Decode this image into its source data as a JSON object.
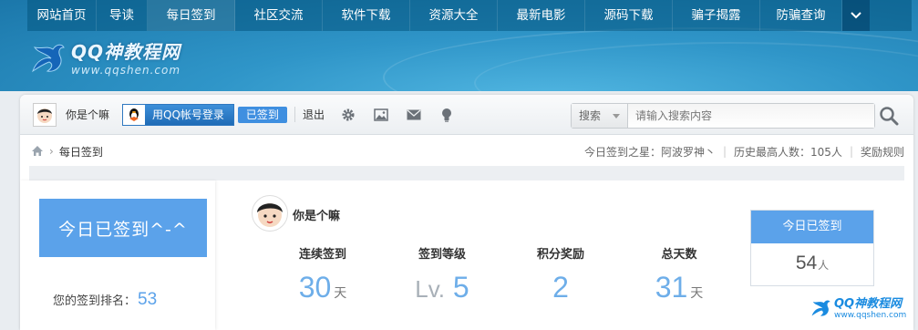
{
  "nav": {
    "items": [
      "网站首页",
      "导读",
      "每日签到",
      "社区交流",
      "软件下载",
      "资源大全",
      "最新电影",
      "源码下载",
      "骗子揭露",
      "防骗查询"
    ],
    "active_index": 2
  },
  "logo": {
    "name": "QQ神教程网",
    "url": "www.qqshen.com"
  },
  "toolbar": {
    "username": "你是个嘛",
    "qq_login_label": "用QQ帐号登录",
    "signed_label": "已签到",
    "logout_label": "退出",
    "icons": [
      "gear-icon",
      "image-icon",
      "mail-icon",
      "bulb-icon"
    ]
  },
  "search": {
    "category": "搜索",
    "placeholder": "请输入搜索内容"
  },
  "breadcrumb": {
    "current": "每日签到"
  },
  "info_bar": {
    "star_label": "今日签到之星：阿波罗神丶",
    "record_label": "历史最高人数：105人",
    "rules_label": "奖励规则"
  },
  "sign_panel": {
    "signed_text": "今日已签到^-^",
    "rank_label": "您的签到排名：",
    "rank_value": "53"
  },
  "user": {
    "name": "你是个嘛"
  },
  "stats": {
    "streak": {
      "label": "连续签到",
      "value": "30",
      "unit": "天"
    },
    "level": {
      "label": "签到等级",
      "prefix": "Lv.",
      "value": "5"
    },
    "points": {
      "label": "积分奖励",
      "value": "2"
    },
    "total": {
      "label": "总天数",
      "value": "31",
      "unit": "天"
    }
  },
  "today": {
    "title": "今日已签到",
    "count": "54",
    "unit": "人"
  },
  "watermark": {
    "name": "QQ神教程网",
    "url": "www.qqshen.com"
  },
  "colors": {
    "accent": "#5ba2ea",
    "nav_bg": "#0a5a86",
    "banner": "#2e98c8"
  }
}
